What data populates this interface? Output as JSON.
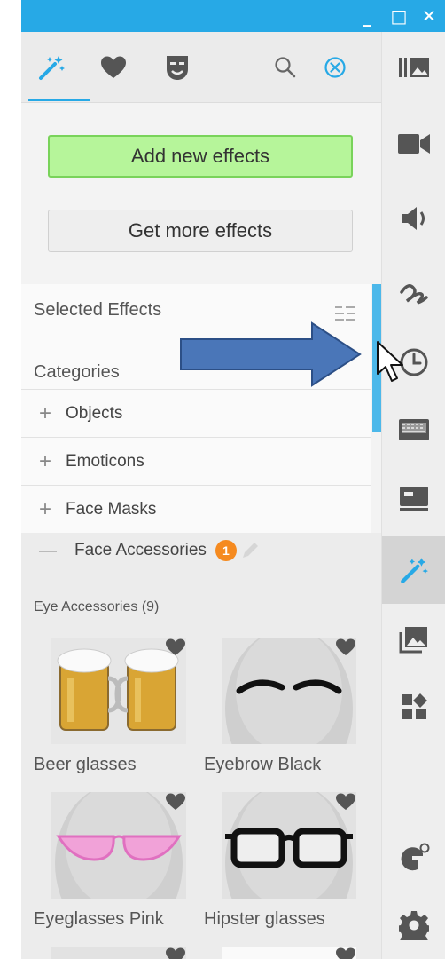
{
  "window_controls": {
    "minimize": "_",
    "maximize": "□",
    "close": "✕"
  },
  "tabs": [
    {
      "icon": "magic-wand-icon",
      "active": true
    },
    {
      "icon": "heart-icon",
      "active": false
    },
    {
      "icon": "mask-icon",
      "active": false
    }
  ],
  "tab_actions": [
    "search-icon",
    "clear-icon"
  ],
  "buttons": {
    "add_new_effects": "Add new effects",
    "get_more_effects": "Get more effects"
  },
  "list": {
    "selected_effects": "Selected Effects",
    "categories": "Categories",
    "groups": [
      {
        "sign": "+",
        "label": "Objects"
      },
      {
        "sign": "+",
        "label": "Emoticons"
      },
      {
        "sign": "+",
        "label": "Face Masks"
      }
    ]
  },
  "accessories": {
    "sign": "—",
    "title": "Face Accessories",
    "badge": "1",
    "subtitle": "Eye Accessories (9)",
    "items": [
      {
        "label": "Beer glasses"
      },
      {
        "label": "Eyebrow Black"
      },
      {
        "label": "Eyeglasses Pink"
      },
      {
        "label": "Hipster glasses"
      }
    ]
  },
  "sidebar": [
    "media-library-icon",
    "video-icon",
    "audio-icon",
    "animation-icon",
    "clock-icon",
    "keyboard-icon",
    "screen-icon",
    "effects-icon",
    "image-icon",
    "widgets-icon",
    "webcam-effects-icon",
    "settings-icon"
  ],
  "colors": {
    "accent": "#27a9e6",
    "add_button": "#b6f59a",
    "badge": "#f58a1f",
    "arrow": "#4a76b8"
  }
}
